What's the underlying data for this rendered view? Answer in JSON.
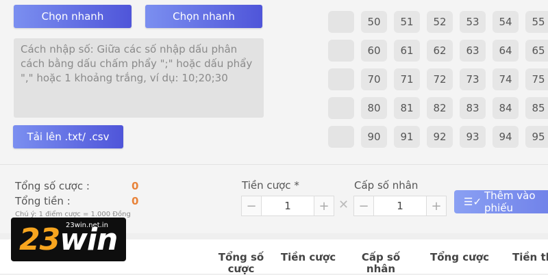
{
  "quick_select": {
    "left_label": "Chọn nhanh",
    "right_label": "Chọn nhanh"
  },
  "input_hint": "Cách nhập số: Giữa các số nhập dấu phân cách bằng dấu chấm phẩy \";\" hoặc dấu phẩy \",\" hoặc 1 khoảng trắng, ví dụ: 10;20;30",
  "upload_label": "Tải lên .txt/ .csv",
  "number_rows": [
    [
      "50",
      "51",
      "52",
      "53",
      "54",
      "55"
    ],
    [
      "60",
      "61",
      "62",
      "63",
      "64",
      "65"
    ],
    [
      "70",
      "71",
      "72",
      "73",
      "74",
      "75"
    ],
    [
      "80",
      "81",
      "82",
      "83",
      "84",
      "85"
    ],
    [
      "90",
      "91",
      "92",
      "93",
      "94",
      "95"
    ]
  ],
  "summary": {
    "total_bets_label": "Tổng số cược :",
    "total_bets_value": "0",
    "total_money_label": "Tổng tiền :",
    "total_money_value": "0",
    "note": "Chú ý: 1 điểm cược = 1.000 Đồng"
  },
  "bet_amount": {
    "label": "Tiền cược *",
    "value": "1"
  },
  "multiplier": {
    "label": "Cấp số nhân",
    "value": "1"
  },
  "add_button_label": "Thêm vào phiếu",
  "table_headers": [
    "Tổng số cược",
    "Tiền cược",
    "Cấp số nhân",
    "Tổng cược",
    "Tiền th"
  ],
  "logo": {
    "main_number": "23",
    "main_word": "win",
    "domain": "23win.net.in"
  }
}
